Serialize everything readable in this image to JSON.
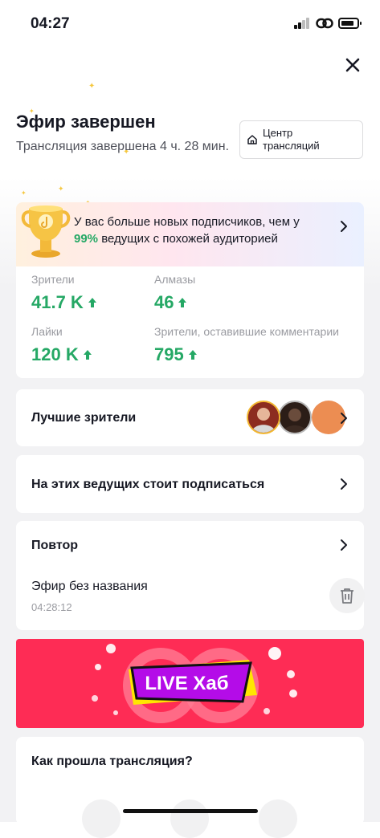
{
  "status_bar": {
    "time": "04:27"
  },
  "header": {
    "title": "Эфир завершен",
    "subtitle": "Трансляция завершена 4 ч. 28 мин.",
    "center_button": "Центр\nтрансляций"
  },
  "stats": {
    "banner_text_pre": "У вас больше новых подписчиков, чем у ",
    "banner_pct": "99%",
    "banner_text_post": " ведущих с похожей аудиторией",
    "items": [
      {
        "label": "Зрители",
        "value": "41.7 K"
      },
      {
        "label": "Алмазы",
        "value": "46"
      },
      {
        "label": "Лайки",
        "value": "120 K"
      },
      {
        "label": "Зрители, оставившие комментарии",
        "value": "795"
      }
    ]
  },
  "top_viewers": {
    "label": "Лучшие зрители"
  },
  "recommend": {
    "label": "На этих ведущих стоит подписаться"
  },
  "replay": {
    "label": "Повтор",
    "item_title": "Эфир без названия",
    "item_duration": "04:28:12"
  },
  "live_hub": {
    "label": "LIVE Хаб"
  },
  "rate": {
    "question": "Как прошла трансляция?"
  },
  "colors": {
    "accent_green": "#25a865",
    "brand_red": "#fe2c55",
    "live_purple": "#b40ce8"
  }
}
